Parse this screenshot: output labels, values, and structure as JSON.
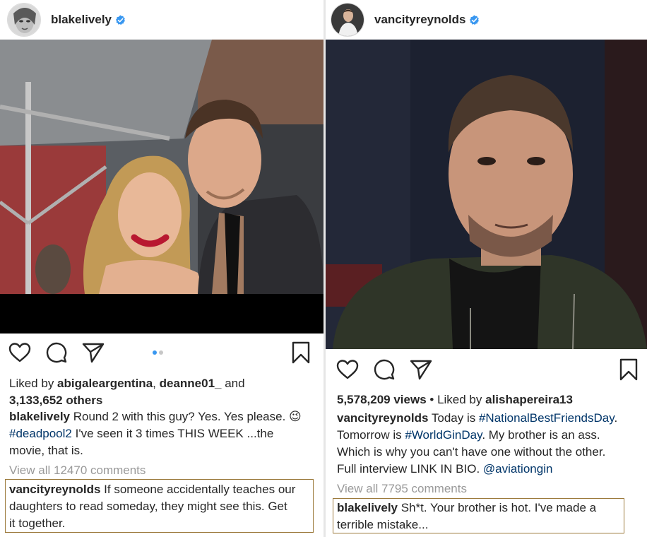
{
  "left_post": {
    "username": "blakelively",
    "liked_prefix": "Liked by ",
    "liked_user_1": "abigaleargentina",
    "liked_sep": ", ",
    "liked_user_2": "deanne01_",
    "liked_and": " and",
    "liked_others": "3,133,652 others",
    "caption_user": "blakelively",
    "caption_line1": " Round 2 with this guy? Yes. Yes please. ",
    "caption_emoji": "😉",
    "caption_hashtag": "#deadpool2",
    "caption_line2": " I've seen it 3 times THIS WEEK ...the",
    "caption_line3": "movie, that is.",
    "view_comments": "View all 12470 comments",
    "comment_user": "vancityreynolds",
    "comment_text_1": " If someone accidentally teaches our",
    "comment_text_2": "daughters to read someday, they might see this. Get",
    "comment_text_3": "it together."
  },
  "right_post": {
    "username": "vancityreynolds",
    "views": "5,578,209 views",
    "views_sep": " • Liked by ",
    "liked_user": "alishapereira13",
    "caption_user": "vancityreynolds",
    "caption_1": " Today is ",
    "caption_tag_1": "#NationalBestFriendsDay",
    "caption_2": ".",
    "caption_3": "Tomorrow is ",
    "caption_tag_2": "#WorldGinDay",
    "caption_4": ". My brother is an ass.",
    "caption_5": "Which is why you can't have one without the other.",
    "caption_6": "Full interview LINK IN BIO. ",
    "caption_mention": "@aviationgin",
    "view_comments": "View all 7795 comments",
    "comment_user": "blakelively",
    "comment_text_1": " Sh*t. Your brother is hot. I've made a",
    "comment_text_2": "terrible mistake..."
  },
  "carousel": {
    "count": 2,
    "active_index": 0
  },
  "icons": [
    "heart-icon",
    "comment-icon",
    "share-icon",
    "bookmark-icon",
    "verified-badge-icon",
    "wink-emoji"
  ],
  "colors": {
    "verified": "#3897f0",
    "hashtag": "#003569",
    "muted": "#999999",
    "highlight_border": "#9c7a3c",
    "text": "#262626"
  }
}
